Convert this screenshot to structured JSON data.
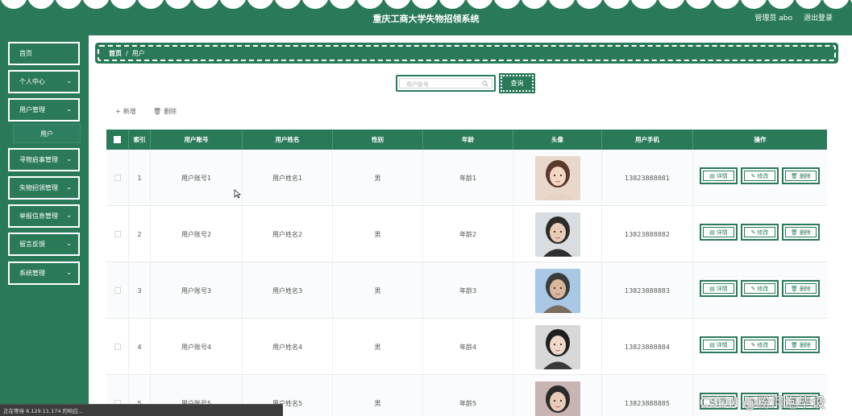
{
  "header": {
    "title": "重庆工商大学失物招领系统",
    "admin_label": "管理员 abo",
    "logout_label": "退出登录"
  },
  "sidebar": {
    "items": [
      {
        "label": "首页",
        "has_chevron": false
      },
      {
        "label": "个人中心",
        "has_chevron": true
      },
      {
        "label": "用户管理",
        "has_chevron": true
      },
      {
        "label": "寻物启事管理",
        "has_chevron": true
      },
      {
        "label": "失物招领管理",
        "has_chevron": true
      },
      {
        "label": "举报信息管理",
        "has_chevron": true
      },
      {
        "label": "留言反馈",
        "has_chevron": true
      },
      {
        "label": "系统管理",
        "has_chevron": true
      }
    ],
    "sub_item": "用户"
  },
  "breadcrumb": {
    "home": "首页",
    "separator": "/",
    "current": "用户"
  },
  "search": {
    "placeholder": "用户账号",
    "button_label": "查询"
  },
  "actions": {
    "add_label": "新增",
    "delete_label": "删除"
  },
  "table": {
    "columns": [
      "索引",
      "用户账号",
      "用户姓名",
      "性别",
      "年龄",
      "头像",
      "用户手机",
      "操作"
    ],
    "rows": [
      {
        "index": "1",
        "account": "用户账号1",
        "name": "用户姓名1",
        "gender": "男",
        "age": "年龄1",
        "phone": "13823888881"
      },
      {
        "index": "2",
        "account": "用户账号2",
        "name": "用户姓名2",
        "gender": "男",
        "age": "年龄2",
        "phone": "13823888882"
      },
      {
        "index": "3",
        "account": "用户账号3",
        "name": "用户姓名3",
        "gender": "男",
        "age": "年龄3",
        "phone": "13823888883"
      },
      {
        "index": "4",
        "account": "用户账号4",
        "name": "用户姓名4",
        "gender": "男",
        "age": "年龄4",
        "phone": "13823888884"
      },
      {
        "index": "5",
        "account": "用户账号5",
        "name": "用户姓名5",
        "gender": "男",
        "age": "年龄5",
        "phone": "13823888885"
      }
    ],
    "row_actions": {
      "detail": "详情",
      "edit": "修改",
      "delete": "删除"
    }
  },
  "statusbar": {
    "text": "正在等待 8.129.11.174 的响应..."
  },
  "watermark": "CSDN @粉河泡毕设",
  "colors": {
    "primary": "#2a7a5a",
    "white": "#ffffff"
  }
}
